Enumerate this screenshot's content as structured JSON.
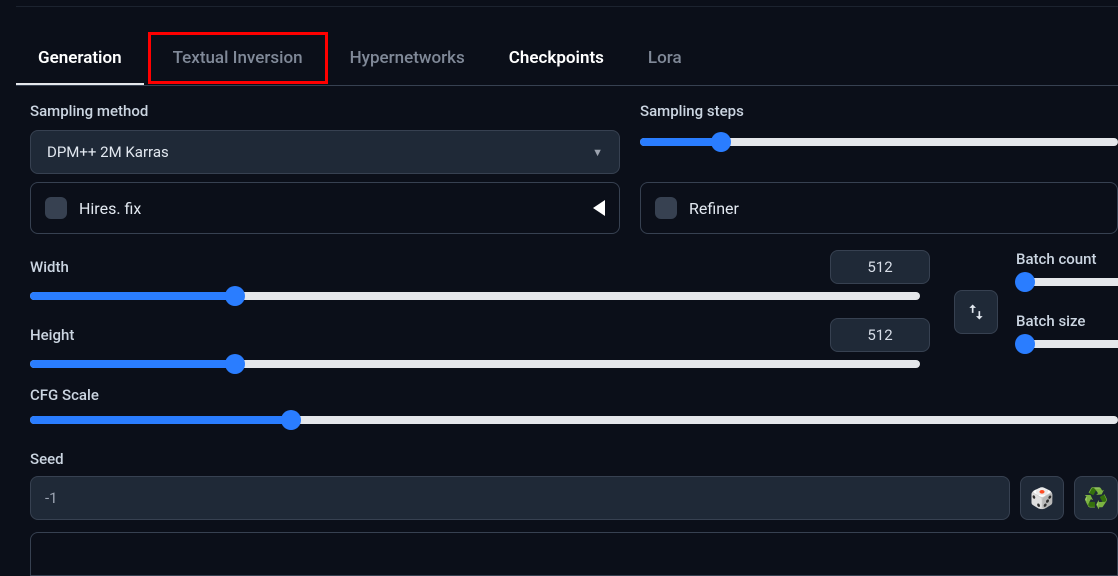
{
  "tabs": {
    "generation": "Generation",
    "textual_inversion": "Textual Inversion",
    "hypernetworks": "Hypernetworks",
    "checkpoints": "Checkpoints",
    "lora": "Lora"
  },
  "labels": {
    "sampling_method": "Sampling method",
    "sampling_steps": "Sampling steps",
    "hires_fix": "Hires. fix",
    "refiner": "Refiner",
    "width": "Width",
    "height": "Height",
    "batch_count": "Batch count",
    "batch_size": "Batch size",
    "cfg_scale": "CFG Scale",
    "seed": "Seed"
  },
  "values": {
    "sampling_method": "DPM++ 2M Karras",
    "width": "512",
    "height": "512",
    "seed": "-1"
  },
  "slider_percent": {
    "sampling_steps": 17,
    "width": 23,
    "height": 23,
    "batch_count": 8,
    "batch_size": 8,
    "cfg": 24
  },
  "icons": {
    "dice": "🎲",
    "recycle": "♻️"
  }
}
